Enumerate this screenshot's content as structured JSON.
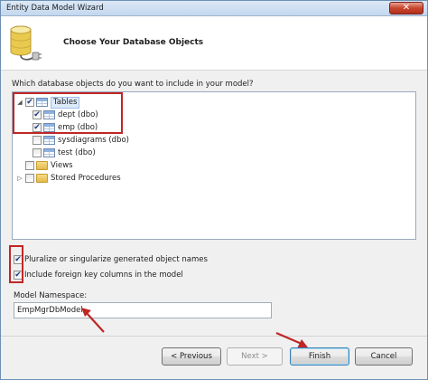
{
  "window": {
    "title": "Entity Data Model Wizard",
    "close_glyph": "✕"
  },
  "header": {
    "title": "Choose Your Database Objects",
    "icon": "database-plug-icon"
  },
  "question": "Which database objects do you want to include in your model?",
  "tree": {
    "tables": {
      "label": "Tables",
      "checked": true,
      "expanded": true,
      "children": [
        {
          "label": "dept (dbo)",
          "checked": true
        },
        {
          "label": "emp (dbo)",
          "checked": true
        },
        {
          "label": "sysdiagrams (dbo)",
          "checked": false
        },
        {
          "label": "test (dbo)",
          "checked": false
        }
      ]
    },
    "views": {
      "label": "Views",
      "checked": false
    },
    "stored_procedures": {
      "label": "Stored Procedures",
      "checked": false
    }
  },
  "options": {
    "pluralize": {
      "label": "Pluralize or singularize generated object names",
      "checked": true
    },
    "foreign_keys": {
      "label": "Include foreign key columns in the model",
      "checked": true
    }
  },
  "namespace": {
    "label": "Model Namespace:",
    "value": "EmpMgrDbModel"
  },
  "buttons": {
    "previous": "< Previous",
    "next": "Next >",
    "finish": "Finish",
    "cancel": "Cancel"
  },
  "colors": {
    "annotation_red": "#c02626",
    "check_blue": "#1d3c85"
  }
}
